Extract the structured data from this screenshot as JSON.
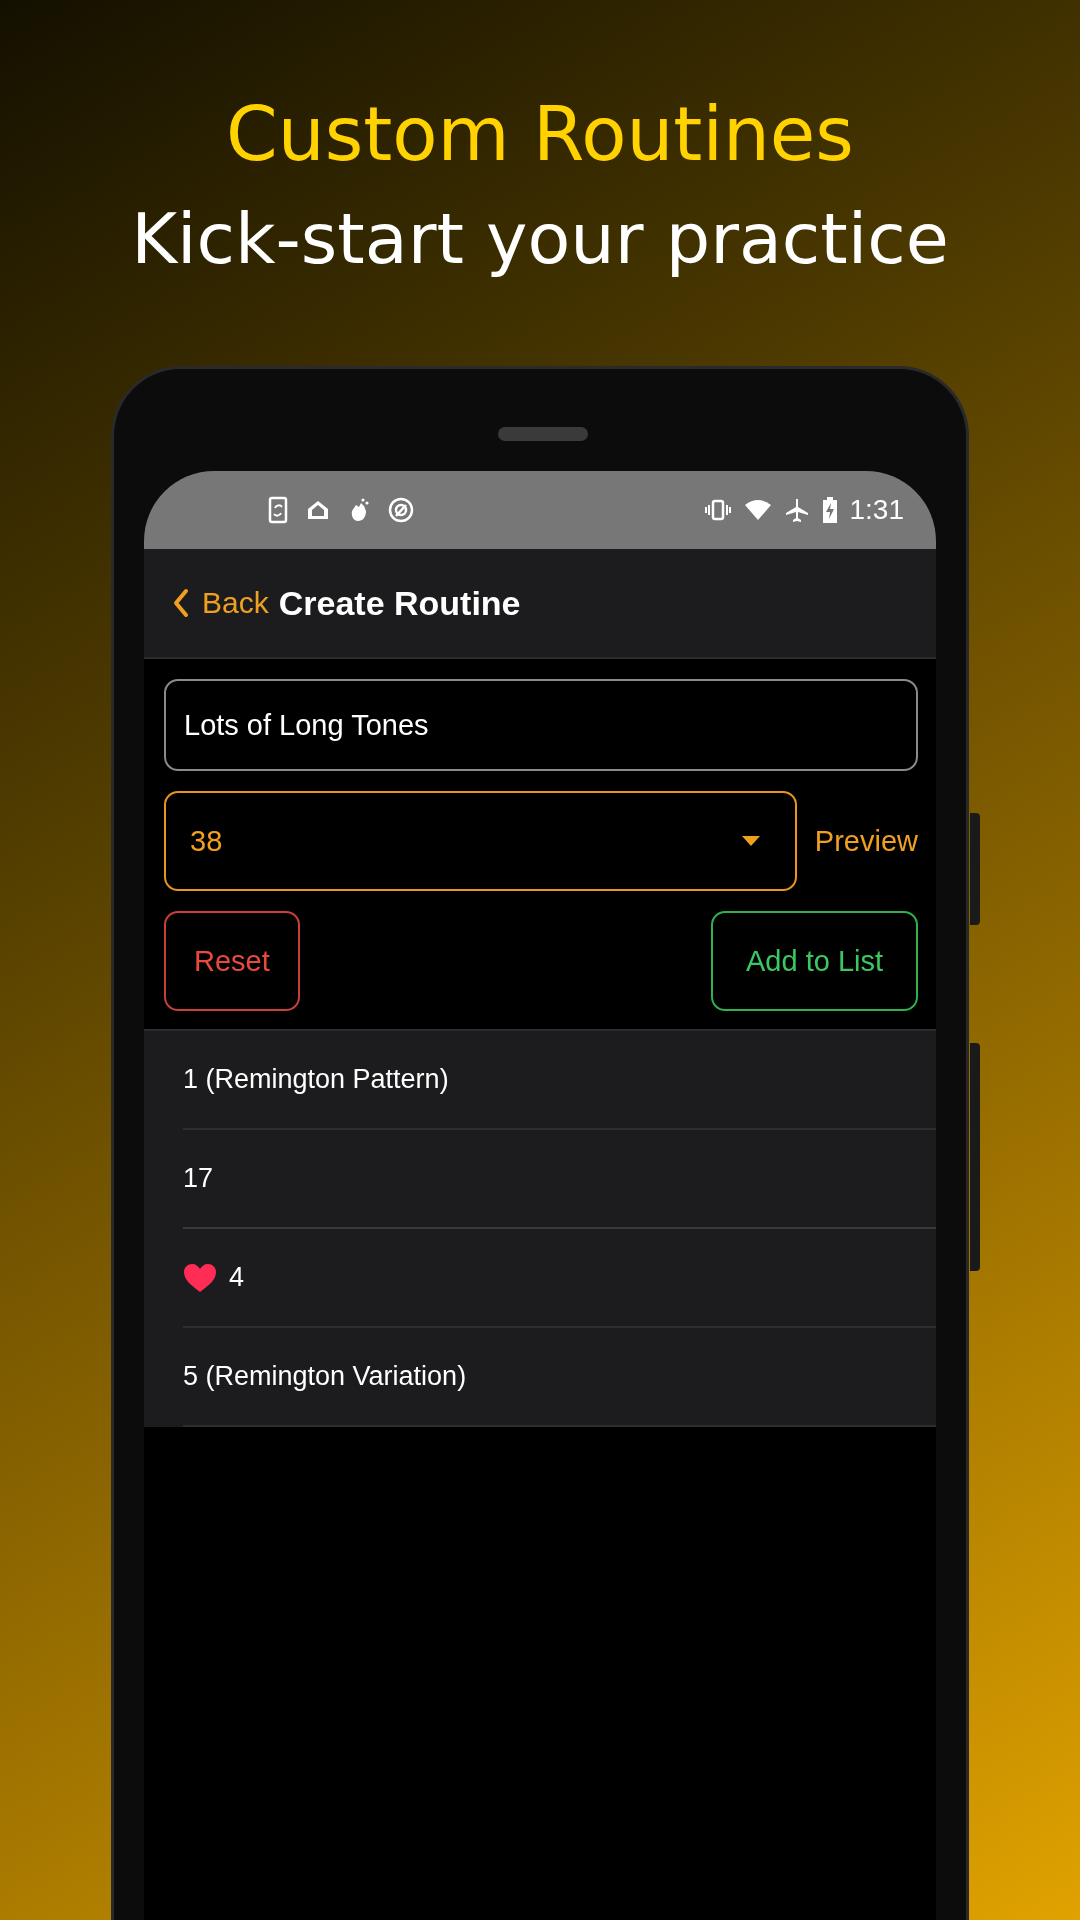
{
  "headline": "Custom Routines",
  "subheadline": "Kick-start your practice",
  "status_bar": {
    "time": "1:31"
  },
  "nav": {
    "back": "Back",
    "title": "Create Routine"
  },
  "name_field": {
    "value": "Lots of Long Tones"
  },
  "number_dropdown": {
    "value": "38"
  },
  "preview": "Preview",
  "buttons": [
    {
      "label": "Reset",
      "kind": "reset"
    },
    {
      "label": "Add to List",
      "kind": "add"
    }
  ],
  "items": [
    {
      "label": "1 (Remington Pattern)",
      "favorite": false
    },
    {
      "label": "17",
      "favorite": false
    },
    {
      "label": "4",
      "favorite": true
    },
    {
      "label": "5 (Remington Variation)",
      "favorite": false
    }
  ]
}
